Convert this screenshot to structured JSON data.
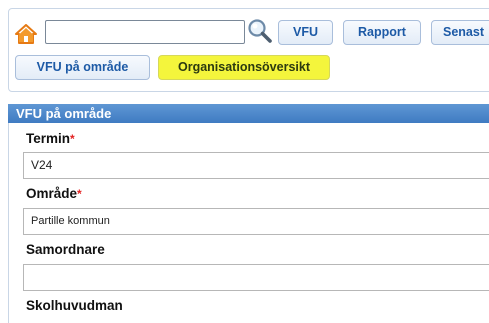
{
  "toolbar": {
    "search_value": "",
    "buttons": {
      "vfu": "VFU",
      "rapport": "Rapport",
      "senast": "Senast",
      "vfu_omrade": "VFU på område",
      "organisation": "Organisationsöversikt"
    },
    "highlight_color": "#f4f53c"
  },
  "section": {
    "title": "VFU på område",
    "header_color": "#4a86c9"
  },
  "form": {
    "termin": {
      "label": "Termin",
      "required": "*",
      "value": "V24"
    },
    "omrade": {
      "label": "Område",
      "required": "*",
      "value": "Partille kommun"
    },
    "samordnare": {
      "label": "Samordnare",
      "value": ""
    },
    "skolhuvudman": {
      "label": "Skolhuvudman"
    }
  },
  "icons": {
    "home": "home-icon",
    "search": "search-icon"
  }
}
